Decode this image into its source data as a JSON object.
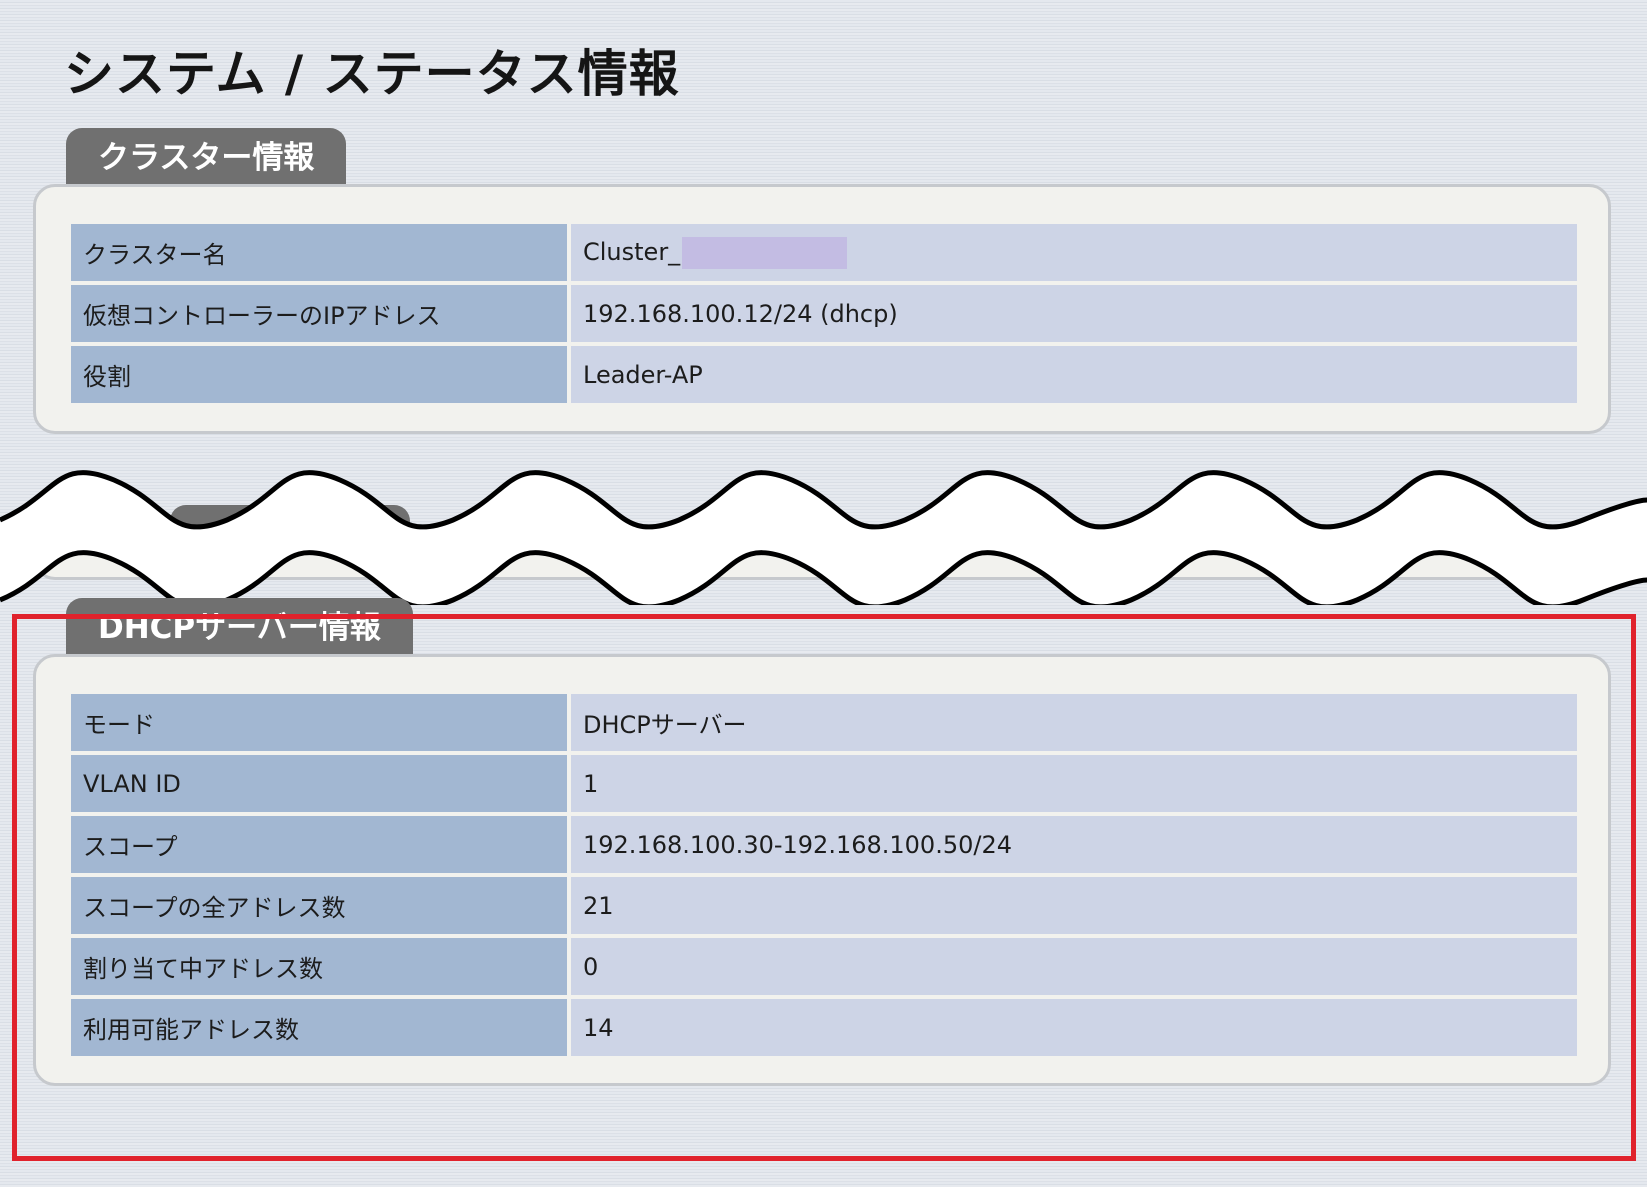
{
  "page_title": "システム / ステータス情報",
  "cluster_section": {
    "title": "クラスター情報",
    "rows": [
      {
        "label": "クラスター名",
        "value": "Cluster_"
      },
      {
        "label": "仮想コントローラーのIPアドレス",
        "value": "192.168.100.12/24 (dhcp)"
      },
      {
        "label": "役割",
        "value": "Leader-AP"
      }
    ]
  },
  "dhcp_section": {
    "title": "DHCPサーバー情報",
    "rows": [
      {
        "label": "モード",
        "value": "DHCPサーバー"
      },
      {
        "label": "VLAN ID",
        "value": "1"
      },
      {
        "label": "スコープ",
        "value": "192.168.100.30-192.168.100.50/24"
      },
      {
        "label": "スコープの全アドレス数",
        "value": "21"
      },
      {
        "label": "割り当て中アドレス数",
        "value": "0"
      },
      {
        "label": "利用可能アドレス数",
        "value": "14"
      }
    ]
  },
  "colors": {
    "highlight": "#e0222c",
    "tab_background": "#707070",
    "label_cell": "#a2b7d2",
    "value_cell": "#cdd4e6",
    "redaction": "#c3bce3"
  }
}
